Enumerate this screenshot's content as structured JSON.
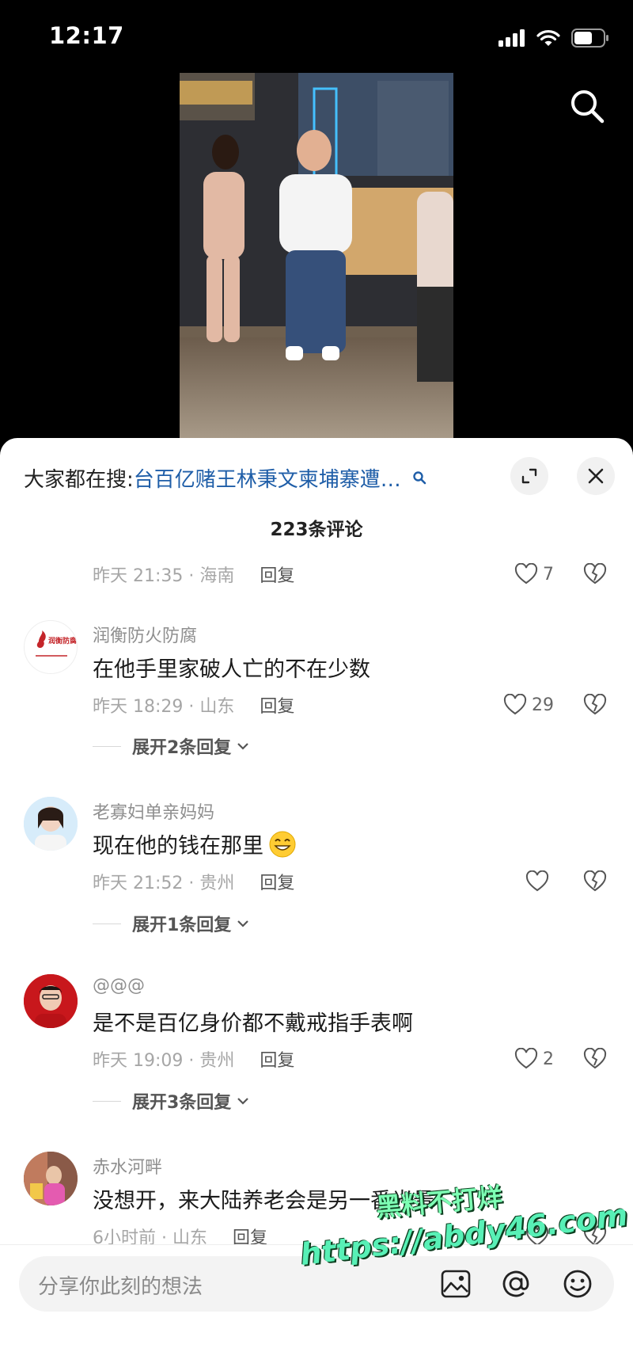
{
  "status": {
    "time": "12:17"
  },
  "trend": {
    "prefix": "大家都在搜:",
    "query": "台百亿赌王林秉文柬埔寨遭…"
  },
  "comment_count": "223条评论",
  "reply_label": "回复",
  "comments": [
    {
      "time": "昨天 21:35 · 海南",
      "likes": "7"
    },
    {
      "name": "润衡防火防腐",
      "text": "在他手里家破人亡的不在少数",
      "time": "昨天 18:29 · 山东",
      "likes": "29",
      "expand": "展开2条回复",
      "avatar_text": "润衡防腐"
    },
    {
      "name": "老寡妇单亲妈妈",
      "text": "现在他的钱在那里",
      "time": "昨天 21:52 · 贵州",
      "likes": "",
      "expand": "展开1条回复"
    },
    {
      "name": "@@@",
      "text": "是不是百亿身价都不戴戒指手表啊",
      "time": "昨天 19:09 · 贵州",
      "likes": "2",
      "expand": "展开3条回复"
    },
    {
      "name": "赤水河畔",
      "text": "没想开，来大陆养老会是另一番光景",
      "time": "6小时前 · 山东",
      "likes": ""
    }
  ],
  "composer": {
    "placeholder": "分享你此刻的想法"
  },
  "watermark": {
    "line1": "黑料不打烊",
    "line2": "https://abdy46.com"
  },
  "colors": {
    "accent": "#1f5ea8",
    "watermark": "#58f0b6"
  }
}
